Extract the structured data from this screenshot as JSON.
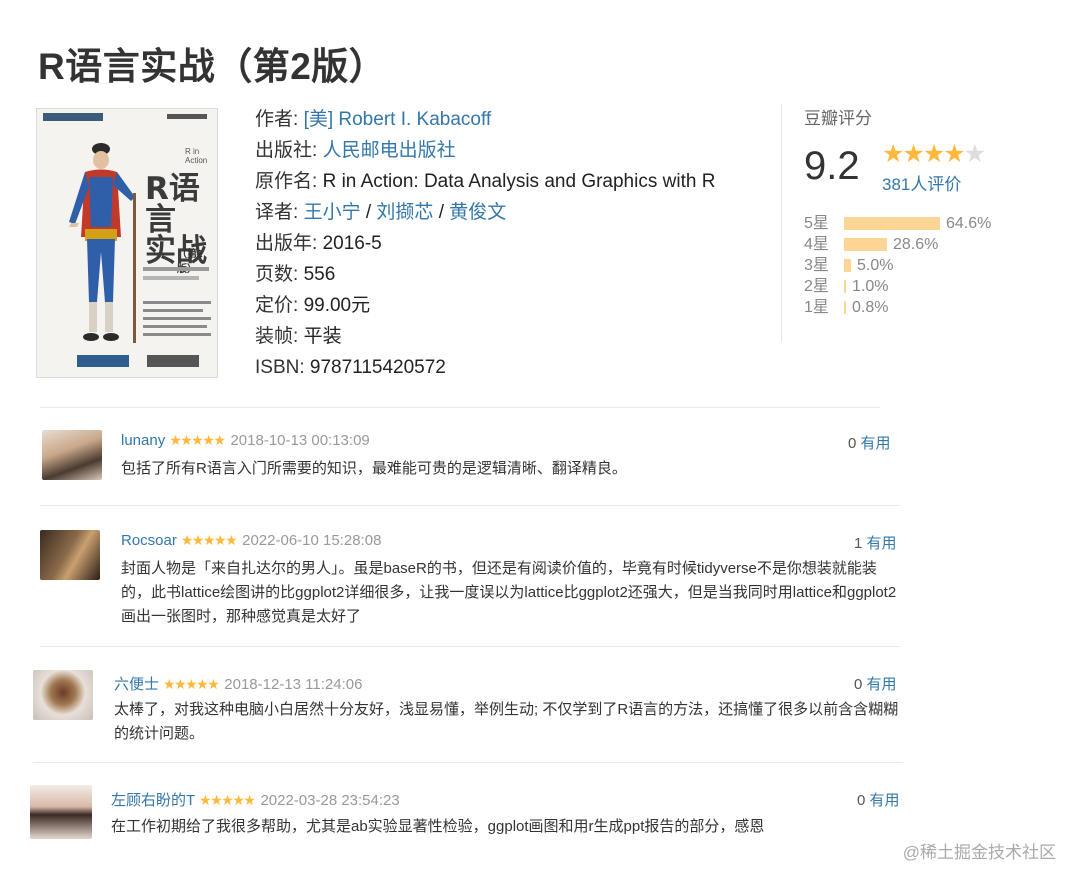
{
  "title": "R语言实战（第2版）",
  "cover": {
    "title_line1": "R语言",
    "title_line2": "实战",
    "edition": "（第2版）",
    "english_title": "R in Action",
    "english_sub": "Data Analysis and Graphics with R Second Edition"
  },
  "info": {
    "author_label": "作者: ",
    "author": "[美] Robert I. Kabacoff",
    "publisher_label": "出版社: ",
    "publisher": "人民邮电出版社",
    "original_label": "原作名: ",
    "original": "R in Action: Data Analysis and Graphics with R",
    "translator_label": "译者: ",
    "translators": [
      "王小宁",
      "刘撷芯",
      "黄俊文"
    ],
    "sep": " / ",
    "year_label": "出版年: ",
    "year": "2016-5",
    "pages_label": "页数: ",
    "pages": "556",
    "price_label": "定价: ",
    "price": "99.00元",
    "binding_label": "装帧: ",
    "binding": "平装",
    "isbn_label": "ISBN: ",
    "isbn": "9787115420572"
  },
  "rating": {
    "label": "豆瓣评分",
    "score": "9.2",
    "stars": "★★★★",
    "half_star": "★",
    "count": "381人评价",
    "star_color": "#ffb83b",
    "bar_color": "#ffd596",
    "distribution": [
      {
        "label": "5星",
        "percent": "64.6%",
        "value": 64.6
      },
      {
        "label": "4星",
        "percent": "28.6%",
        "value": 28.6
      },
      {
        "label": "3星",
        "percent": "5.0%",
        "value": 5.0
      },
      {
        "label": "2星",
        "percent": "1.0%",
        "value": 1.0
      },
      {
        "label": "1星",
        "percent": "0.8%",
        "value": 0.8
      }
    ]
  },
  "comments": [
    {
      "user": "lunany",
      "stars": "★★★★★",
      "date": "2018-10-13 00:13:09",
      "votes": "0",
      "useful": "有用",
      "text": "包括了所有R语言入门所需要的知识，最难能可贵的是逻辑清晰、翻译精良。"
    },
    {
      "user": "Rocsoar",
      "stars": "★★★★★",
      "date": "2022-06-10 15:28:08",
      "votes": "1",
      "useful": "有用",
      "text": "封面人物是「来自扎达尔的男人」。虽是baseR的书，但还是有阅读价值的，毕竟有时候tidyverse不是你想装就能装的，此书lattice绘图讲的比ggplot2详细很多，让我一度误以为lattice比ggplot2还强大，但是当我同时用lattice和ggplot2画出一张图时，那种感觉真是太好了"
    },
    {
      "user": "六便士",
      "stars": "★★★★★",
      "date": "2018-12-13 11:24:06",
      "votes": "0",
      "useful": "有用",
      "text": "太棒了，对我这种电脑小白居然十分友好，浅显易懂，举例生动; 不仅学到了R语言的方法，还搞懂了很多以前含含糊糊的统计问题。"
    },
    {
      "user": "左顾右盼的T",
      "stars": "★★★★★",
      "date": "2022-03-28 23:54:23",
      "votes": "0",
      "useful": "有用",
      "text": "在工作初期给了我很多帮助，尤其是ab实验显著性检验，ggplot画图和用r生成ppt报告的部分，感恩"
    }
  ],
  "watermark": "@稀土掘金技术社区"
}
